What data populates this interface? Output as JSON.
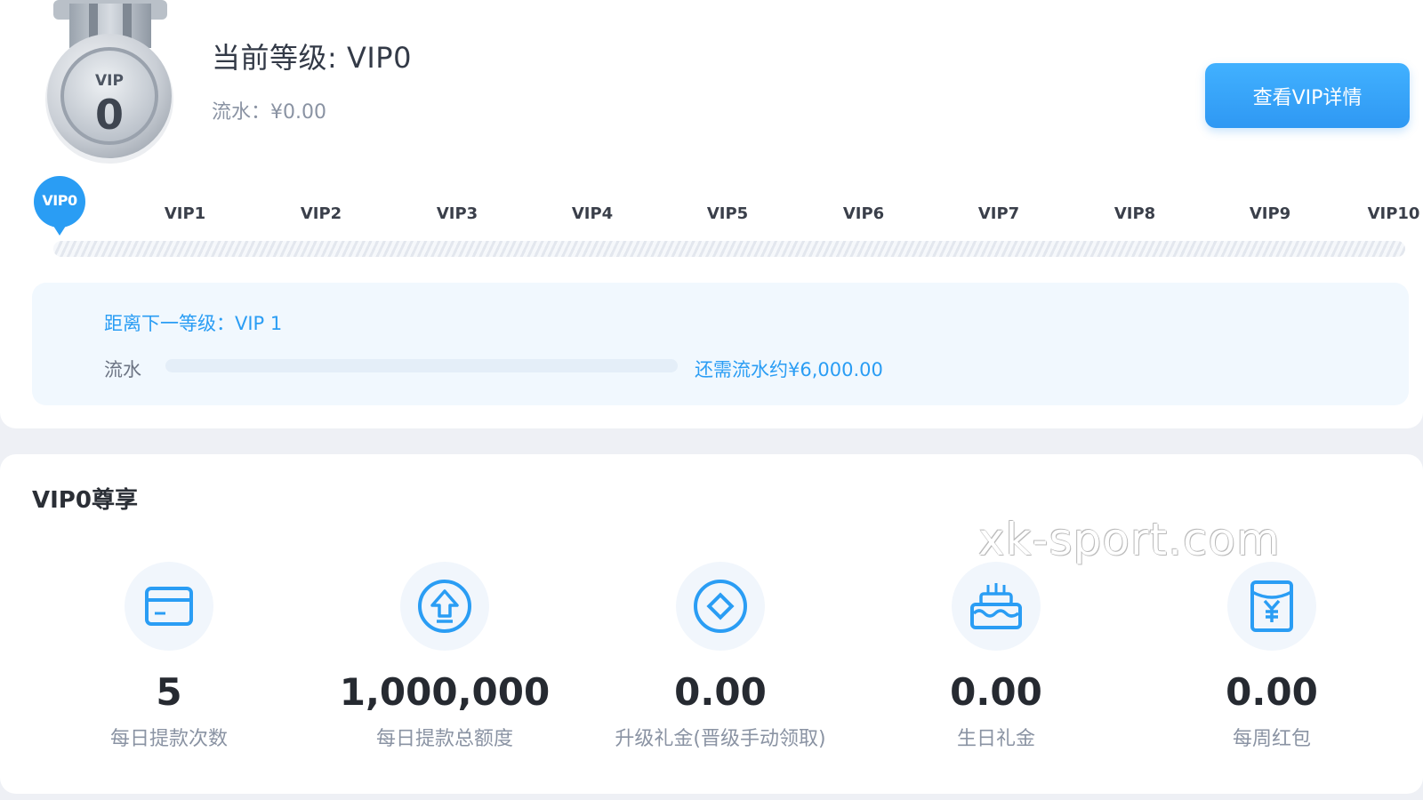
{
  "current": {
    "medal_vip": "VIP",
    "medal_level": "0",
    "title": "当前等级: VIP0",
    "turnover": "流水：¥0.00",
    "details_button": "查看VIP详情"
  },
  "levels": {
    "current_pin": "VIP0",
    "items": [
      "VIP1",
      "VIP2",
      "VIP3",
      "VIP4",
      "VIP5",
      "VIP6",
      "VIP7",
      "VIP8",
      "VIP9",
      "VIP10"
    ]
  },
  "next_level": {
    "label": "距离下一等级：VIP 1",
    "flow_label": "流水",
    "flow_progress": 0,
    "remaining": "还需流水约¥6,000.00"
  },
  "privileges": {
    "title": "VIP0尊享",
    "watermark": "xk-sport.com",
    "items": [
      {
        "icon": "credit-card-icon",
        "value": "5",
        "label": "每日提款次数"
      },
      {
        "icon": "upload-circle-icon",
        "value": "1,000,000",
        "label": "每日提款总额度"
      },
      {
        "icon": "diamond-circle-icon",
        "value": "0.00",
        "label": "升级礼金(晋级手动领取)"
      },
      {
        "icon": "birthday-cake-icon",
        "value": "0.00",
        "label": "生日礼金"
      },
      {
        "icon": "red-envelope-icon",
        "value": "0.00",
        "label": "每周红包"
      }
    ]
  },
  "colors": {
    "accent": "#2a9df4",
    "button": "#3aa6fb",
    "text": "#333a47",
    "muted": "#8a93a3"
  }
}
